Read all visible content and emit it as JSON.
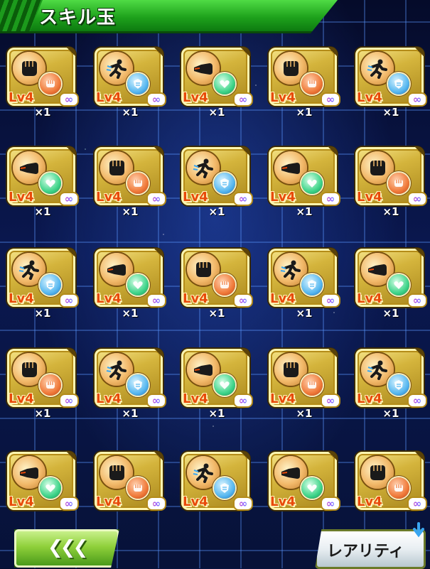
{
  "header": {
    "title": "スキル玉"
  },
  "items": [
    {
      "main": "fist",
      "sub": "red",
      "level": "Lv4",
      "infinite": "∞",
      "qty": "×1"
    },
    {
      "main": "runner",
      "sub": "blue",
      "level": "Lv4",
      "infinite": "∞",
      "qty": "×1"
    },
    {
      "main": "punch",
      "sub": "green",
      "level": "Lv4",
      "infinite": "∞",
      "qty": "×1"
    },
    {
      "main": "fist",
      "sub": "red",
      "level": "Lv4",
      "infinite": "∞",
      "qty": "×1"
    },
    {
      "main": "runner",
      "sub": "blue",
      "level": "Lv4",
      "infinite": "∞",
      "qty": "×1"
    },
    {
      "main": "punch",
      "sub": "green",
      "level": "Lv4",
      "infinite": "∞",
      "qty": "×1"
    },
    {
      "main": "fist",
      "sub": "red",
      "level": "Lv4",
      "infinite": "∞",
      "qty": "×1"
    },
    {
      "main": "runner",
      "sub": "blue",
      "level": "Lv4",
      "infinite": "∞",
      "qty": "×1"
    },
    {
      "main": "punch",
      "sub": "green",
      "level": "Lv4",
      "infinite": "∞",
      "qty": "×1"
    },
    {
      "main": "fist",
      "sub": "red",
      "level": "Lv4",
      "infinite": "∞",
      "qty": "×1"
    },
    {
      "main": "runner",
      "sub": "blue",
      "level": "Lv4",
      "infinite": "∞",
      "qty": "×1"
    },
    {
      "main": "punch",
      "sub": "green",
      "level": "Lv4",
      "infinite": "∞",
      "qty": "×1"
    },
    {
      "main": "fist",
      "sub": "red",
      "level": "Lv4",
      "infinite": "∞",
      "qty": "×1"
    },
    {
      "main": "runner",
      "sub": "blue",
      "level": "Lv4",
      "infinite": "∞",
      "qty": "×1"
    },
    {
      "main": "punch",
      "sub": "green",
      "level": "Lv4",
      "infinite": "∞",
      "qty": "×1"
    },
    {
      "main": "fist",
      "sub": "red",
      "level": "Lv4",
      "infinite": "∞",
      "qty": "×1"
    },
    {
      "main": "runner",
      "sub": "blue",
      "level": "Lv4",
      "infinite": "∞",
      "qty": "×1"
    },
    {
      "main": "punch",
      "sub": "green",
      "level": "Lv4",
      "infinite": "∞",
      "qty": "×1"
    },
    {
      "main": "fist",
      "sub": "red",
      "level": "Lv4",
      "infinite": "∞",
      "qty": "×1"
    },
    {
      "main": "runner",
      "sub": "blue",
      "level": "Lv4",
      "infinite": "∞",
      "qty": "×1"
    },
    {
      "main": "punch",
      "sub": "green",
      "level": "Lv4",
      "infinite": "∞",
      "qty": ""
    },
    {
      "main": "fist",
      "sub": "red",
      "level": "Lv4",
      "infinite": "∞",
      "qty": ""
    },
    {
      "main": "runner",
      "sub": "blue",
      "level": "Lv4",
      "infinite": "∞",
      "qty": ""
    },
    {
      "main": "punch",
      "sub": "green",
      "level": "Lv4",
      "infinite": "∞",
      "qty": ""
    },
    {
      "main": "fist",
      "sub": "red",
      "level": "Lv4",
      "infinite": "∞",
      "qty": ""
    }
  ],
  "footer": {
    "back_label": "❮❮❮",
    "sort_label": "レアリティ"
  },
  "colors": {
    "header": "#1ea21c",
    "level_text": "#e84a0a",
    "back_button": "#8fd03a"
  }
}
